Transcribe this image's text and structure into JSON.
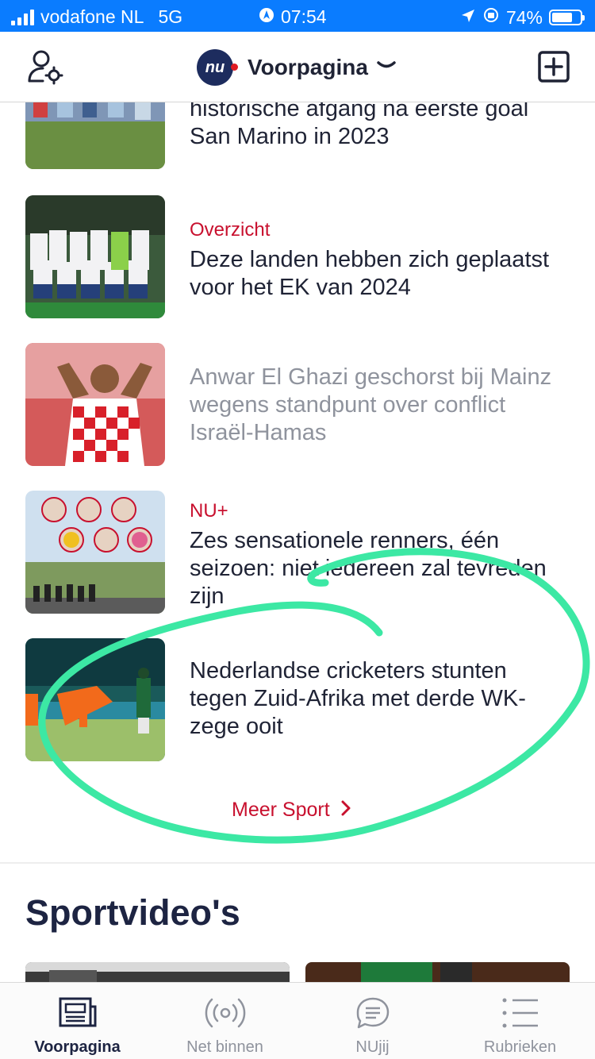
{
  "status_bar": {
    "carrier": "vodafone NL",
    "network": "5G",
    "time": "07:54",
    "battery": "74%",
    "battery_level": 0.74
  },
  "header": {
    "logo_text": "nu",
    "title": "Voorpagina"
  },
  "articles": [
    {
      "label": "",
      "headline": "historische afgang na eerste goal San Marino in 2023",
      "read": false
    },
    {
      "label": "Overzicht",
      "headline": "Deze landen hebben zich geplaatst voor het EK van 2024",
      "read": false
    },
    {
      "label": "",
      "headline": "Anwar El Ghazi geschorst bij Mainz wegens standpunt over conflict Israël-Hamas",
      "read": true
    },
    {
      "label": "NU+",
      "headline": "Zes sensationele renners, één seizoen: niet iedereen zal tevreden zijn",
      "read": false
    },
    {
      "label": "",
      "headline": "Nederlandse cricketers stunten tegen Zuid-Afrika met derde WK-zege ooit",
      "read": false
    }
  ],
  "more_link": "Meer Sport",
  "section": {
    "title": "Sportvideo's"
  },
  "tabs": [
    {
      "label": "Voorpagina",
      "active": true
    },
    {
      "label": "Net binnen",
      "active": false
    },
    {
      "label": "NUjij",
      "active": false
    },
    {
      "label": "Rubrieken",
      "active": false
    }
  ],
  "colors": {
    "status_bar": "#0a7cff",
    "accent_red": "#c8102e",
    "text_dark": "#1f2335",
    "text_read": "#8f939d",
    "annotation_green": "#3ce8a4"
  }
}
